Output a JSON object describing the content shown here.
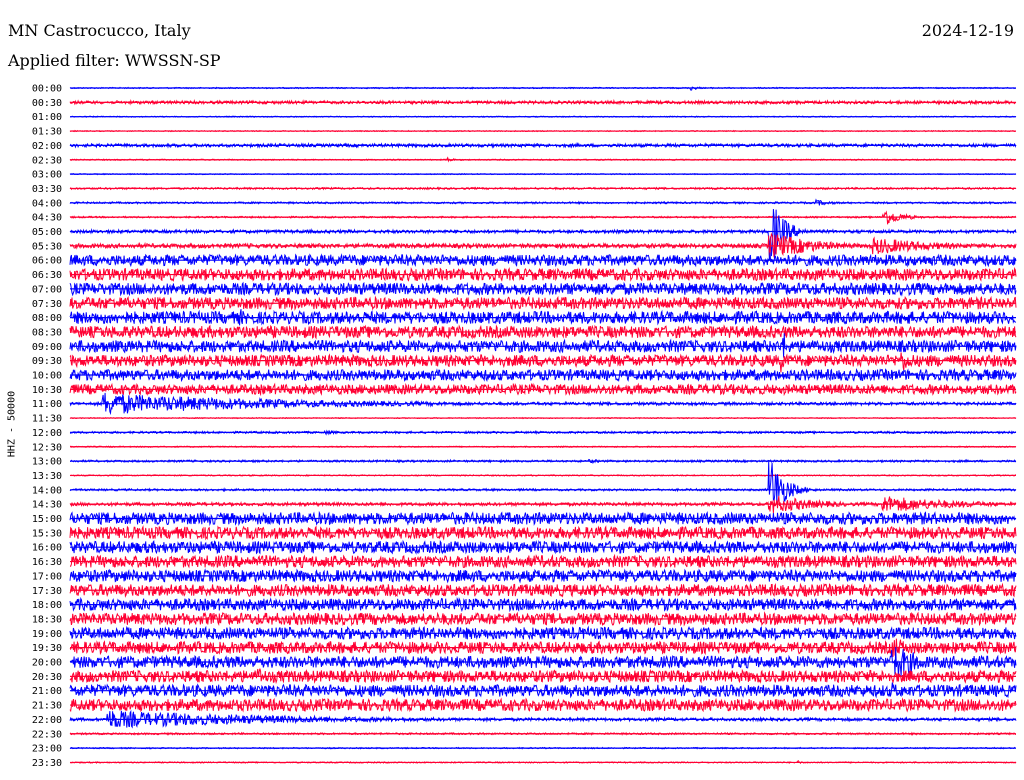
{
  "header": {
    "station": "MN Castrocucco, Italy",
    "date": "2024-12-19",
    "filter": "Applied filter: WWSSN-SP"
  },
  "y_axis_label": "HHZ - 50000",
  "colors": {
    "blue": "#0000ff",
    "red": "#ff0033"
  },
  "chart_data": {
    "type": "line",
    "title": "MN Castrocucco, Italy",
    "date": "2024-12-19",
    "filter": "WWSSN-SP",
    "ylabel": "HHZ - 50000",
    "traces": [
      {
        "label": "00:00",
        "color": "blue",
        "noise": 0.6,
        "events": [
          {
            "t": 0.657,
            "amp": 2.5,
            "dur": 0.008
          }
        ]
      },
      {
        "label": "00:30",
        "color": "red",
        "noise": 1.5,
        "events": []
      },
      {
        "label": "01:00",
        "color": "blue",
        "noise": 0.5,
        "events": []
      },
      {
        "label": "01:30",
        "color": "red",
        "noise": 0.5,
        "events": []
      },
      {
        "label": "02:00",
        "color": "blue",
        "noise": 1.6,
        "events": []
      },
      {
        "label": "02:30",
        "color": "red",
        "noise": 0.6,
        "events": [
          {
            "t": 0.4,
            "amp": 2.5,
            "dur": 0.006
          }
        ]
      },
      {
        "label": "03:00",
        "color": "blue",
        "noise": 0.5,
        "events": []
      },
      {
        "label": "03:30",
        "color": "red",
        "noise": 0.9,
        "events": []
      },
      {
        "label": "04:00",
        "color": "blue",
        "noise": 0.9,
        "events": [
          {
            "t": 0.79,
            "amp": 3,
            "dur": 0.02
          }
        ]
      },
      {
        "label": "04:30",
        "color": "red",
        "noise": 0.8,
        "events": [
          {
            "t": 0.86,
            "amp": 10,
            "dur": 0.018
          }
        ]
      },
      {
        "label": "05:00",
        "color": "blue",
        "noise": 1.6,
        "events": [
          {
            "t": 0.74,
            "amp": 34,
            "dur": 0.015
          }
        ]
      },
      {
        "label": "05:30",
        "color": "red",
        "noise": 2.2,
        "events": [
          {
            "t": 0.74,
            "amp": 14,
            "dur": 0.05
          },
          {
            "t": 0.85,
            "amp": 9,
            "dur": 0.07
          }
        ]
      },
      {
        "label": "06:00",
        "color": "blue",
        "noise": 5.5,
        "events": [
          {
            "t": 0.74,
            "amp": 8,
            "dur": 0.02
          }
        ]
      },
      {
        "label": "06:30",
        "color": "red",
        "noise": 6,
        "events": []
      },
      {
        "label": "07:00",
        "color": "blue",
        "noise": 6,
        "events": []
      },
      {
        "label": "07:30",
        "color": "red",
        "noise": 6,
        "events": []
      },
      {
        "label": "08:00",
        "color": "blue",
        "noise": 6.2,
        "events": [
          {
            "t": 0.18,
            "amp": 9,
            "dur": 0.01
          },
          {
            "t": 0.88,
            "amp": 8,
            "dur": 0.04
          }
        ]
      },
      {
        "label": "08:30",
        "color": "red",
        "noise": 6,
        "events": []
      },
      {
        "label": "09:00",
        "color": "blue",
        "noise": 6,
        "events": [
          {
            "t": 0.755,
            "amp": 14,
            "dur": 0.006
          }
        ]
      },
      {
        "label": "09:30",
        "color": "red",
        "noise": 5.8,
        "events": [
          {
            "t": 0.753,
            "amp": 12,
            "dur": 0.006
          },
          {
            "t": 0.88,
            "amp": 11,
            "dur": 0.02
          }
        ]
      },
      {
        "label": "10:00",
        "color": "blue",
        "noise": 5.5,
        "events": []
      },
      {
        "label": "10:30",
        "color": "red",
        "noise": 5,
        "events": []
      },
      {
        "label": "11:00",
        "color": "blue",
        "noise": 1.5,
        "events": [
          {
            "t": 0.036,
            "amp": 12,
            "dur": 0.12
          },
          {
            "t": 0.1,
            "amp": 8,
            "dur": 0.2
          }
        ]
      },
      {
        "label": "11:30",
        "color": "red",
        "noise": 0.5,
        "events": []
      },
      {
        "label": "12:00",
        "color": "blue",
        "noise": 1,
        "events": [
          {
            "t": 0.27,
            "amp": 2,
            "dur": 0.02
          }
        ]
      },
      {
        "label": "12:30",
        "color": "red",
        "noise": 0.6,
        "events": []
      },
      {
        "label": "13:00",
        "color": "blue",
        "noise": 1,
        "events": [
          {
            "t": 0.55,
            "amp": 2,
            "dur": 0.02
          }
        ]
      },
      {
        "label": "13:30",
        "color": "red",
        "noise": 0.6,
        "events": []
      },
      {
        "label": "14:00",
        "color": "blue",
        "noise": 1,
        "events": [
          {
            "t": 0.74,
            "amp": 34,
            "dur": 0.015
          }
        ]
      },
      {
        "label": "14:30",
        "color": "red",
        "noise": 1.6,
        "events": [
          {
            "t": 0.74,
            "amp": 10,
            "dur": 0.05
          },
          {
            "t": 0.86,
            "amp": 9,
            "dur": 0.08
          }
        ]
      },
      {
        "label": "15:00",
        "color": "blue",
        "noise": 6,
        "events": []
      },
      {
        "label": "15:30",
        "color": "red",
        "noise": 6,
        "events": []
      },
      {
        "label": "16:00",
        "color": "blue",
        "noise": 6,
        "events": []
      },
      {
        "label": "16:30",
        "color": "red",
        "noise": 6,
        "events": []
      },
      {
        "label": "17:00",
        "color": "blue",
        "noise": 6,
        "events": []
      },
      {
        "label": "17:30",
        "color": "red",
        "noise": 6,
        "events": []
      },
      {
        "label": "18:00",
        "color": "blue",
        "noise": 6,
        "events": []
      },
      {
        "label": "18:30",
        "color": "red",
        "noise": 6,
        "events": []
      },
      {
        "label": "19:00",
        "color": "blue",
        "noise": 6,
        "events": []
      },
      {
        "label": "19:30",
        "color": "red",
        "noise": 6,
        "events": [
          {
            "t": 0.87,
            "amp": 12,
            "dur": 0.02
          }
        ]
      },
      {
        "label": "20:00",
        "color": "blue",
        "noise": 6,
        "events": [
          {
            "t": 0.87,
            "amp": 20,
            "dur": 0.03
          }
        ]
      },
      {
        "label": "20:30",
        "color": "red",
        "noise": 6,
        "events": [
          {
            "t": 0.2,
            "amp": 10,
            "dur": 0.015
          }
        ]
      },
      {
        "label": "21:00",
        "color": "blue",
        "noise": 6,
        "events": [
          {
            "t": 0.87,
            "amp": 9,
            "dur": 0.01
          }
        ]
      },
      {
        "label": "21:30",
        "color": "red",
        "noise": 6,
        "events": []
      },
      {
        "label": "22:00",
        "color": "blue",
        "noise": 1.5,
        "events": [
          {
            "t": 0.04,
            "amp": 10,
            "dur": 0.12
          },
          {
            "t": 0.1,
            "amp": 7,
            "dur": 0.2
          }
        ]
      },
      {
        "label": "22:30",
        "color": "red",
        "noise": 0.9,
        "events": []
      },
      {
        "label": "23:00",
        "color": "blue",
        "noise": 0.6,
        "events": []
      },
      {
        "label": "23:30",
        "color": "red",
        "noise": 0.6,
        "events": [
          {
            "t": 0.77,
            "amp": 2,
            "dur": 0.004
          }
        ]
      }
    ]
  }
}
